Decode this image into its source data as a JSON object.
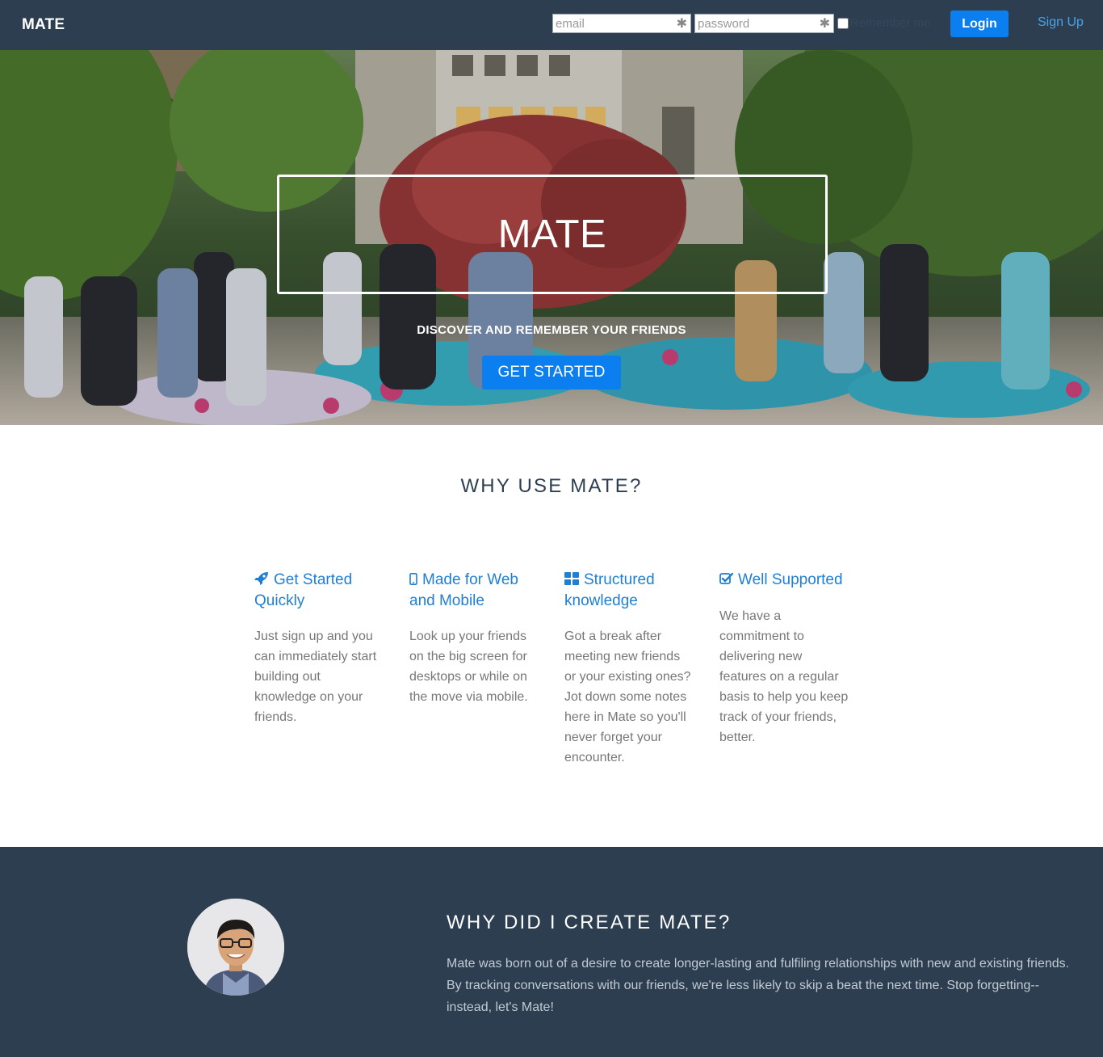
{
  "navbar": {
    "brand": "MATE",
    "email_placeholder": "email",
    "password_placeholder": "password",
    "required_mark": "✱",
    "remember_label": "Remember me",
    "login_label": "Login",
    "signup_label": "Sign Up"
  },
  "hero": {
    "title": "MATE",
    "subtitle": "DISCOVER AND REMEMBER YOUR FRIENDS",
    "cta_label": "GET STARTED"
  },
  "why": {
    "title": "WHY USE MATE?",
    "features": [
      {
        "icon": "rocket-icon",
        "title": "Get Started Quickly",
        "text": "Just sign up and you can immediately start building out knowledge on your friends."
      },
      {
        "icon": "mobile-icon",
        "title": "Made for Web and Mobile",
        "text": "Look up your friends on the big screen for desktops or while on the move via mobile."
      },
      {
        "icon": "grid-icon",
        "title": "Structured knowledge",
        "text": "Got a break after meeting new friends or your existing ones? Jot down some notes here in Mate so you'll never forget your encounter."
      },
      {
        "icon": "check-square-icon",
        "title": "Well Supported",
        "text": "We have a commitment to delivering new features on a regular basis to help you keep track of your friends, better."
      }
    ]
  },
  "about": {
    "title": "WHY DID I CREATE MATE?",
    "text": "Mate was born out of a desire to create longer-lasting and fulfiling relationships with new and existing friends. By tracking conversations with our friends, we're less likely to skip a beat the next time. Stop forgetting--instead, let's Mate!"
  },
  "colors": {
    "navbar_bg": "#2c3e50",
    "primary_button": "#0c7ff0",
    "feature_heading": "#1f7fd4",
    "signup_link": "#4aa3ec"
  }
}
